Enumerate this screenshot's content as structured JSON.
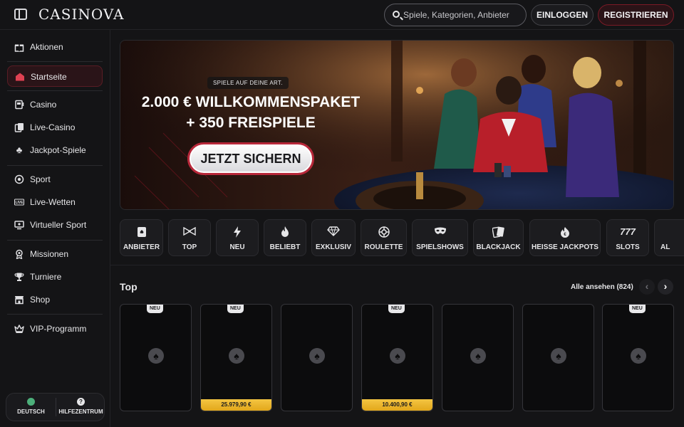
{
  "header": {
    "logo_text": "CASINOVA",
    "search_placeholder": "Spiele, Kategorien, Anbieter",
    "login_label": "EINLOGGEN",
    "register_label": "REGISTRIEREN"
  },
  "sidebar": {
    "items": [
      {
        "label": "Aktionen",
        "icon": "gift-icon"
      },
      {
        "label": "Startseite",
        "icon": "home-icon",
        "active": true
      },
      {
        "label": "Casino",
        "icon": "slot-machine-icon"
      },
      {
        "label": "Live-Casino",
        "icon": "live-cards-icon"
      },
      {
        "label": "Jackpot-Spiele",
        "icon": "clover-icon"
      },
      {
        "label": "Sport",
        "icon": "football-icon"
      },
      {
        "label": "Live-Wetten",
        "icon": "live-badge-icon"
      },
      {
        "label": "Virtueller Sport",
        "icon": "monitor-icon"
      },
      {
        "label": "Missionen",
        "icon": "mission-icon"
      },
      {
        "label": "Turniere",
        "icon": "trophy-icon"
      },
      {
        "label": "Shop",
        "icon": "shop-icon"
      },
      {
        "label": "VIP-Programm",
        "icon": "crown-icon"
      }
    ],
    "language_label": "DEUTSCH",
    "help_label": "HILFEZENTRUM"
  },
  "banner": {
    "eyebrow": "SPIELE AUF DEINE ART.",
    "headline_line1": "2.000 € WILLKOMMENSPAKET",
    "headline_line2": "+ 350 FREISPIELE",
    "cta_label": "JETZT SICHERN"
  },
  "categories": [
    {
      "label": "ANBIETER",
      "icon": "provider-icon"
    },
    {
      "label": "TOP",
      "icon": "bowtie-icon"
    },
    {
      "label": "NEU",
      "icon": "lightning-icon"
    },
    {
      "label": "BELIEBT",
      "icon": "flame-icon"
    },
    {
      "label": "EXKLUSIV",
      "icon": "diamond-icon"
    },
    {
      "label": "ROULETTE",
      "icon": "roulette-icon"
    },
    {
      "label": "SPIELSHOWS",
      "icon": "mask-icon"
    },
    {
      "label": "BLACKJACK",
      "icon": "cards-icon"
    },
    {
      "label": "HEISSE JACKPOTS",
      "icon": "hot-jackpot-icon"
    },
    {
      "label": "SLOTS",
      "icon": "sevens-icon"
    },
    {
      "label": "AL",
      "icon": "all-icon"
    }
  ],
  "top_section": {
    "title": "Top",
    "see_all_label": "Alle ansehen (824)",
    "games": [
      {
        "badge": "NEU",
        "jackpot": ""
      },
      {
        "badge": "NEU",
        "jackpot": "25.979,90 €"
      },
      {
        "badge": "",
        "jackpot": ""
      },
      {
        "badge": "NEU",
        "jackpot": "10.400,90 €"
      },
      {
        "badge": "",
        "jackpot": ""
      },
      {
        "badge": "",
        "jackpot": ""
      },
      {
        "badge": "NEU",
        "jackpot": ""
      }
    ]
  },
  "colors": {
    "accent_red": "#b8283a",
    "jackpot_gold": "#f4c542",
    "background": "#141416"
  }
}
